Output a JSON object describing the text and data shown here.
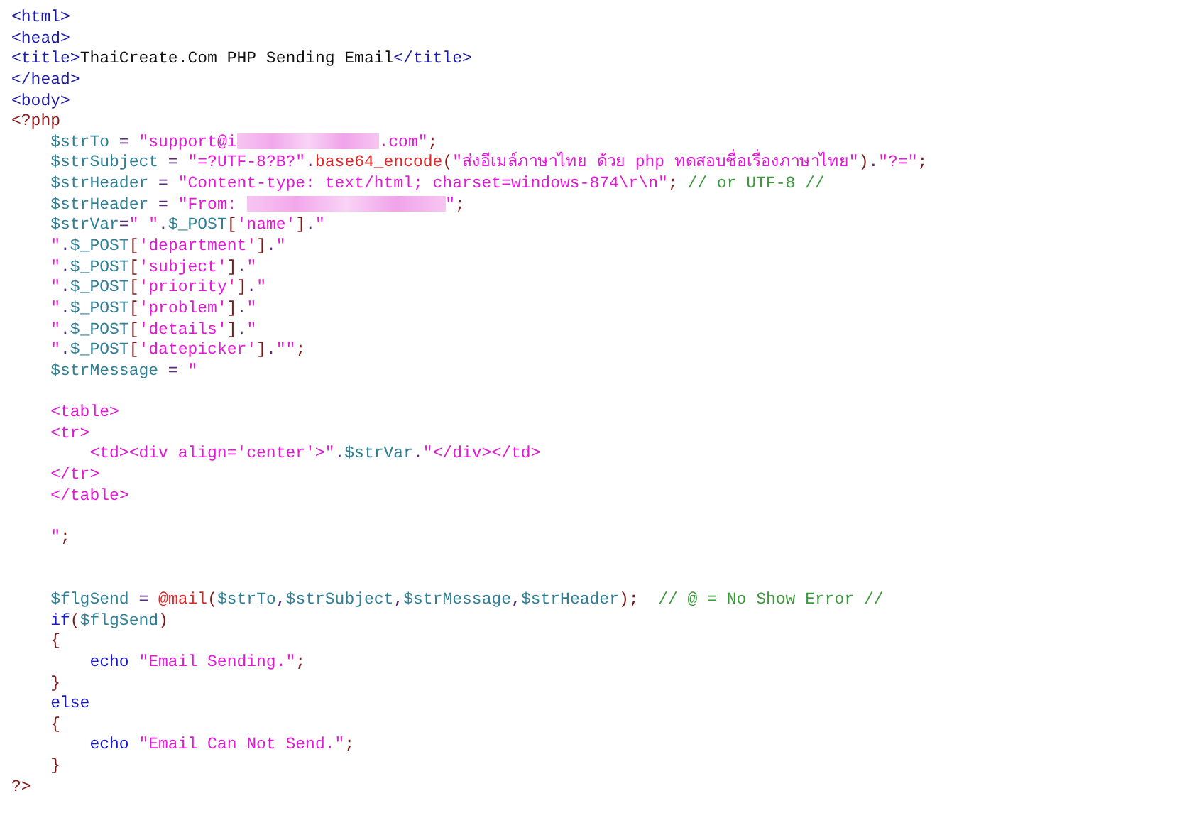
{
  "code_lines": [
    {
      "kind": "code",
      "tokens": [
        {
          "kind": "tag",
          "text": "<html>"
        }
      ]
    },
    {
      "kind": "code",
      "tokens": [
        {
          "kind": "tag",
          "text": "<head>"
        }
      ]
    },
    {
      "kind": "code",
      "tokens": [
        {
          "kind": "tag",
          "text": "<title>"
        },
        {
          "kind": "plain",
          "text": "ThaiCreate.Com PHP Sending Email"
        },
        {
          "kind": "tag",
          "text": "</title>"
        }
      ]
    },
    {
      "kind": "code",
      "tokens": [
        {
          "kind": "tag",
          "text": "</head>"
        }
      ]
    },
    {
      "kind": "code",
      "tokens": [
        {
          "kind": "tag",
          "text": "<body>"
        }
      ]
    },
    {
      "kind": "code",
      "tokens": [
        {
          "kind": "php",
          "text": "<?php"
        }
      ]
    },
    {
      "kind": "code",
      "tokens": [
        {
          "kind": "var",
          "text": "    $strTo"
        },
        {
          "kind": "op",
          "text": " = "
        },
        {
          "kind": "str",
          "text": "\"support@i"
        },
        {
          "kind": "redacted"
        },
        {
          "kind": "str",
          "text": ".com\""
        },
        {
          "kind": "punct",
          "text": ";"
        }
      ]
    },
    {
      "kind": "code",
      "tokens": [
        {
          "kind": "var",
          "text": "    $strSubject"
        },
        {
          "kind": "op",
          "text": " = "
        },
        {
          "kind": "str",
          "text": "\"=?UTF-8?B?\""
        },
        {
          "kind": "op",
          "text": "."
        },
        {
          "kind": "func",
          "text": "base64_encode"
        },
        {
          "kind": "punct",
          "text": "("
        },
        {
          "kind": "str",
          "text": "\"ส่งอีเมล์ภาษาไทย ด้วย php ทดสอบชื่อเรื่องภาษาไทย\""
        },
        {
          "kind": "punct",
          "text": ")"
        },
        {
          "kind": "op",
          "text": "."
        },
        {
          "kind": "str",
          "text": "\"?=\""
        },
        {
          "kind": "punct",
          "text": ";"
        }
      ]
    },
    {
      "kind": "code",
      "tokens": [
        {
          "kind": "var",
          "text": "    $strHeader"
        },
        {
          "kind": "op",
          "text": " = "
        },
        {
          "kind": "str",
          "text": "\"Content-type: text/html; charset=windows-874\\r\\n\""
        },
        {
          "kind": "punct",
          "text": ";"
        },
        {
          "kind": "comment",
          "text": " // or UTF-8 //"
        }
      ]
    },
    {
      "kind": "code",
      "tokens": [
        {
          "kind": "var",
          "text": "    $strHeader"
        },
        {
          "kind": "op",
          "text": " = "
        },
        {
          "kind": "str",
          "text": "\"From: "
        },
        {
          "kind": "redacted"
        },
        {
          "kind": "str",
          "text": "\""
        },
        {
          "kind": "punct",
          "text": ";"
        }
      ]
    },
    {
      "kind": "code",
      "tokens": [
        {
          "kind": "var",
          "text": "    $strVar"
        },
        {
          "kind": "op",
          "text": "="
        },
        {
          "kind": "str",
          "text": "\" \""
        },
        {
          "kind": "op",
          "text": "."
        },
        {
          "kind": "var",
          "text": "$_POST"
        },
        {
          "kind": "punct",
          "text": "["
        },
        {
          "kind": "str",
          "text": "'name'"
        },
        {
          "kind": "punct",
          "text": "]"
        },
        {
          "kind": "op",
          "text": "."
        },
        {
          "kind": "str",
          "text": "\""
        }
      ]
    },
    {
      "kind": "code",
      "tokens": [
        {
          "kind": "str",
          "text": "    \""
        },
        {
          "kind": "op",
          "text": "."
        },
        {
          "kind": "var",
          "text": "$_POST"
        },
        {
          "kind": "punct",
          "text": "["
        },
        {
          "kind": "str",
          "text": "'department'"
        },
        {
          "kind": "punct",
          "text": "]"
        },
        {
          "kind": "op",
          "text": "."
        },
        {
          "kind": "str",
          "text": "\""
        }
      ]
    },
    {
      "kind": "code",
      "tokens": [
        {
          "kind": "str",
          "text": "    \""
        },
        {
          "kind": "op",
          "text": "."
        },
        {
          "kind": "var",
          "text": "$_POST"
        },
        {
          "kind": "punct",
          "text": "["
        },
        {
          "kind": "str",
          "text": "'subject'"
        },
        {
          "kind": "punct",
          "text": "]"
        },
        {
          "kind": "op",
          "text": "."
        },
        {
          "kind": "str",
          "text": "\""
        }
      ]
    },
    {
      "kind": "code",
      "tokens": [
        {
          "kind": "str",
          "text": "    \""
        },
        {
          "kind": "op",
          "text": "."
        },
        {
          "kind": "var",
          "text": "$_POST"
        },
        {
          "kind": "punct",
          "text": "["
        },
        {
          "kind": "str",
          "text": "'priority'"
        },
        {
          "kind": "punct",
          "text": "]"
        },
        {
          "kind": "op",
          "text": "."
        },
        {
          "kind": "str",
          "text": "\""
        }
      ]
    },
    {
      "kind": "code",
      "tokens": [
        {
          "kind": "str",
          "text": "    \""
        },
        {
          "kind": "op",
          "text": "."
        },
        {
          "kind": "var",
          "text": "$_POST"
        },
        {
          "kind": "punct",
          "text": "["
        },
        {
          "kind": "str",
          "text": "'problem'"
        },
        {
          "kind": "punct",
          "text": "]"
        },
        {
          "kind": "op",
          "text": "."
        },
        {
          "kind": "str",
          "text": "\""
        }
      ]
    },
    {
      "kind": "code",
      "tokens": [
        {
          "kind": "str",
          "text": "    \""
        },
        {
          "kind": "op",
          "text": "."
        },
        {
          "kind": "var",
          "text": "$_POST"
        },
        {
          "kind": "punct",
          "text": "["
        },
        {
          "kind": "str",
          "text": "'details'"
        },
        {
          "kind": "punct",
          "text": "]"
        },
        {
          "kind": "op",
          "text": "."
        },
        {
          "kind": "str",
          "text": "\""
        }
      ]
    },
    {
      "kind": "code",
      "tokens": [
        {
          "kind": "str",
          "text": "    \""
        },
        {
          "kind": "op",
          "text": "."
        },
        {
          "kind": "var",
          "text": "$_POST"
        },
        {
          "kind": "punct",
          "text": "["
        },
        {
          "kind": "str",
          "text": "'datepicker'"
        },
        {
          "kind": "punct",
          "text": "]"
        },
        {
          "kind": "op",
          "text": "."
        },
        {
          "kind": "str",
          "text": "\"\""
        },
        {
          "kind": "punct",
          "text": ";"
        }
      ]
    },
    {
      "kind": "code",
      "tokens": [
        {
          "kind": "var",
          "text": "    $strMessage"
        },
        {
          "kind": "op",
          "text": " = "
        },
        {
          "kind": "str",
          "text": "\""
        }
      ]
    },
    {
      "kind": "blank"
    },
    {
      "kind": "code",
      "tokens": [
        {
          "kind": "str",
          "text": "    <table>"
        }
      ]
    },
    {
      "kind": "code",
      "tokens": [
        {
          "kind": "str",
          "text": "    <tr>"
        }
      ]
    },
    {
      "kind": "code",
      "tokens": [
        {
          "kind": "str",
          "text": "        <td><div align='center'>\""
        },
        {
          "kind": "op",
          "text": "."
        },
        {
          "kind": "var",
          "text": "$strVar"
        },
        {
          "kind": "op",
          "text": "."
        },
        {
          "kind": "str",
          "text": "\"</div></td>"
        }
      ]
    },
    {
      "kind": "code",
      "tokens": [
        {
          "kind": "str",
          "text": "    </tr>"
        }
      ]
    },
    {
      "kind": "code",
      "tokens": [
        {
          "kind": "str",
          "text": "    </table>"
        }
      ]
    },
    {
      "kind": "blank"
    },
    {
      "kind": "code",
      "tokens": [
        {
          "kind": "str",
          "text": "    \""
        },
        {
          "kind": "punct",
          "text": ";"
        }
      ]
    },
    {
      "kind": "blank"
    },
    {
      "kind": "blank"
    },
    {
      "kind": "code",
      "tokens": [
        {
          "kind": "var",
          "text": "    $flgSend"
        },
        {
          "kind": "op",
          "text": " = "
        },
        {
          "kind": "func",
          "text": "@mail"
        },
        {
          "kind": "punct",
          "text": "("
        },
        {
          "kind": "var",
          "text": "$strTo"
        },
        {
          "kind": "op",
          "text": ","
        },
        {
          "kind": "var",
          "text": "$strSubject"
        },
        {
          "kind": "op",
          "text": ","
        },
        {
          "kind": "var",
          "text": "$strMessage"
        },
        {
          "kind": "op",
          "text": ","
        },
        {
          "kind": "var",
          "text": "$strHeader"
        },
        {
          "kind": "punct",
          "text": ");"
        },
        {
          "kind": "comment",
          "text": "  // @ = No Show Error //"
        }
      ]
    },
    {
      "kind": "code",
      "tokens": [
        {
          "kind": "keyword",
          "text": "    if"
        },
        {
          "kind": "punct",
          "text": "("
        },
        {
          "kind": "var",
          "text": "$flgSend"
        },
        {
          "kind": "punct",
          "text": ")"
        }
      ]
    },
    {
      "kind": "code",
      "tokens": [
        {
          "kind": "punct",
          "text": "    {"
        }
      ]
    },
    {
      "kind": "code",
      "tokens": [
        {
          "kind": "keyword",
          "text": "        echo "
        },
        {
          "kind": "str",
          "text": "\"Email Sending.\""
        },
        {
          "kind": "punct",
          "text": ";"
        }
      ]
    },
    {
      "kind": "code",
      "tokens": [
        {
          "kind": "punct",
          "text": "    }"
        }
      ]
    },
    {
      "kind": "code",
      "tokens": [
        {
          "kind": "keyword",
          "text": "    else"
        }
      ]
    },
    {
      "kind": "code",
      "tokens": [
        {
          "kind": "punct",
          "text": "    {"
        }
      ]
    },
    {
      "kind": "code",
      "tokens": [
        {
          "kind": "keyword",
          "text": "        echo "
        },
        {
          "kind": "str",
          "text": "\"Email Can Not Send.\""
        },
        {
          "kind": "punct",
          "text": ";"
        }
      ]
    },
    {
      "kind": "code",
      "tokens": [
        {
          "kind": "punct",
          "text": "    }"
        }
      ]
    },
    {
      "kind": "code",
      "tokens": [
        {
          "kind": "php",
          "text": "?>"
        }
      ]
    }
  ]
}
